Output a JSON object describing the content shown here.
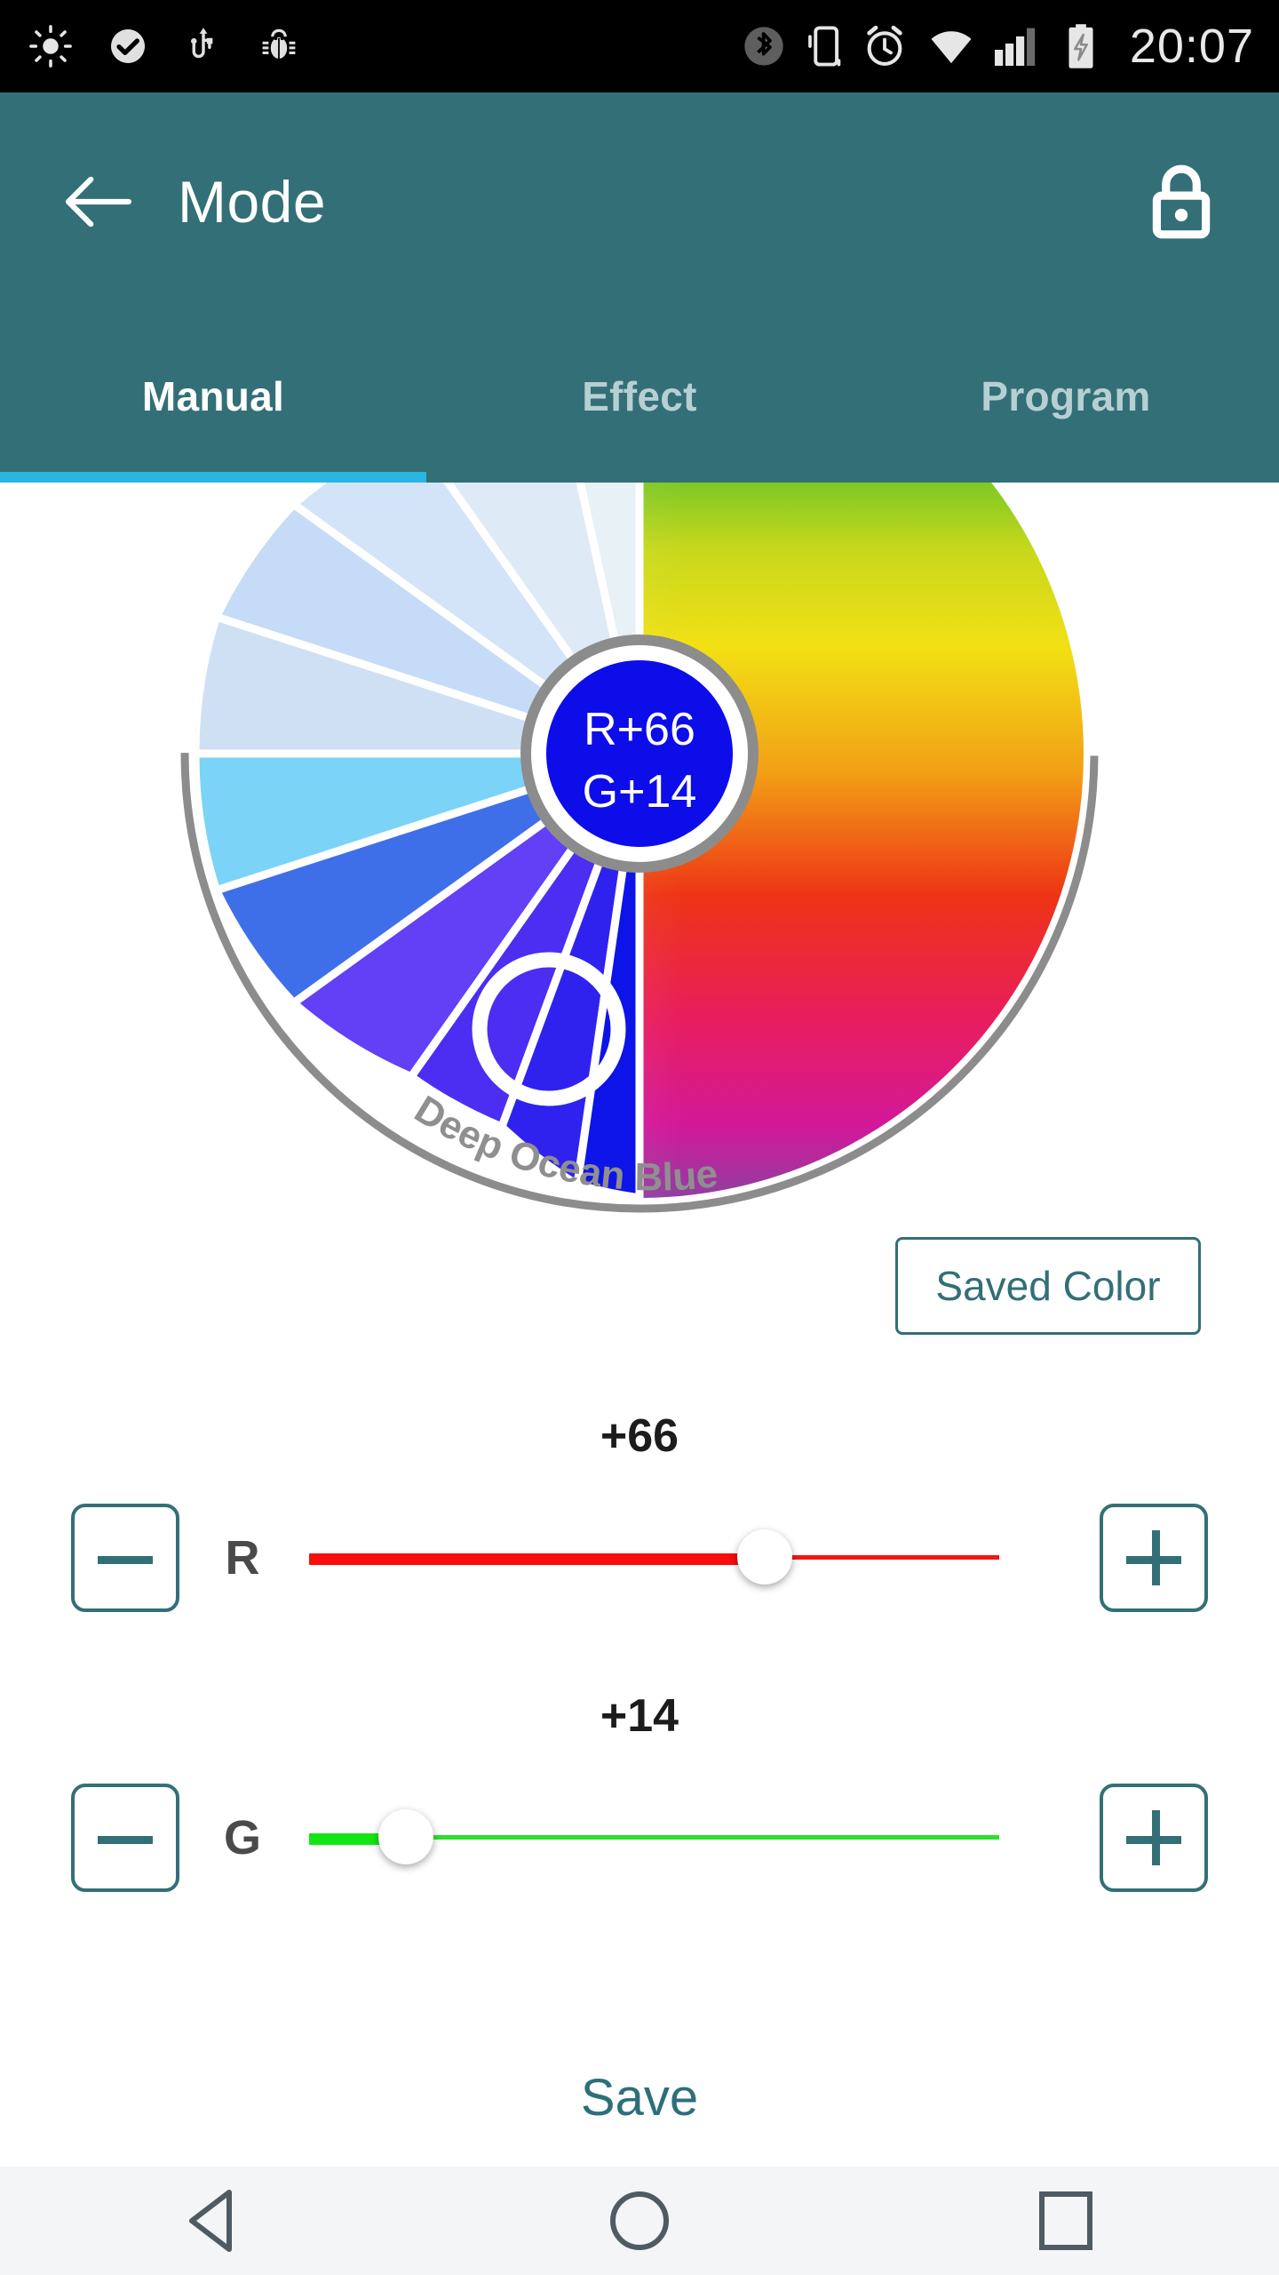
{
  "status_bar": {
    "time": "20:07",
    "left_icons": [
      "brightness-icon",
      "check-circle-icon",
      "usb-icon",
      "bug-icon"
    ],
    "right_icons": [
      "bluetooth-icon",
      "vibrate-icon",
      "alarm-icon",
      "wifi-icon",
      "signal-icon",
      "battery-charging-icon"
    ]
  },
  "header": {
    "title": "Mode",
    "back_icon": "arrow-left-icon",
    "lock_icon": "lock-icon",
    "background_color": "#336f77"
  },
  "tabs": {
    "items": [
      {
        "label": "Manual",
        "active": true
      },
      {
        "label": "Effect",
        "active": false
      },
      {
        "label": "Program",
        "active": false
      }
    ],
    "indicator_color": "#29b6e0",
    "active_color": "#ffffff",
    "inactive_color": "#b7cfd3"
  },
  "color_wheel": {
    "center_label_line1": "R+66",
    "center_label_line2": "G+14",
    "center_color": "#0d0dea",
    "selected_swatch_name": "Deep Ocean Blue",
    "selected_swatch_color": "#0d14e8",
    "ring_outline_color": "#8c8c8c",
    "left_segment_colors": [
      "#e3edf2",
      "#dde8f7",
      "#c9dcf7",
      "#b8d3f7",
      "#6bcbf5",
      "#3c6fe8",
      "#5b3ff2",
      "#4b2df0",
      "#3a2aee",
      "#2a1fec",
      "#0d14e8"
    ],
    "right_gradient_colors": [
      "#1fb34a",
      "#6ec42b",
      "#e8e01a",
      "#f0a018",
      "#ef2a14",
      "#e8198b",
      "#9c3b9e"
    ]
  },
  "saved_color_button": {
    "label": "Saved Color",
    "border_color": "#336f77",
    "text_color": "#336f77"
  },
  "sliders": [
    {
      "channel": "R",
      "value_label": "+66",
      "value": 66,
      "min": 0,
      "max": 100,
      "percent": 66,
      "track_color": "#f90d0d",
      "minus_label": "−",
      "plus_label": "+"
    },
    {
      "channel": "G",
      "value_label": "+14",
      "value": 14,
      "min": 0,
      "max": 100,
      "percent": 14,
      "track_color": "#12e612",
      "minus_label": "−",
      "plus_label": "+"
    }
  ],
  "save_button": {
    "label": "Save",
    "text_color": "#2d6f79"
  },
  "nav_bar": {
    "buttons": [
      {
        "name": "back",
        "icon": "triangle-back-icon"
      },
      {
        "name": "home",
        "icon": "circle-home-icon"
      },
      {
        "name": "recents",
        "icon": "square-recents-icon"
      }
    ],
    "background_color": "#f4f5f6",
    "icon_color": "#4f5b62"
  }
}
